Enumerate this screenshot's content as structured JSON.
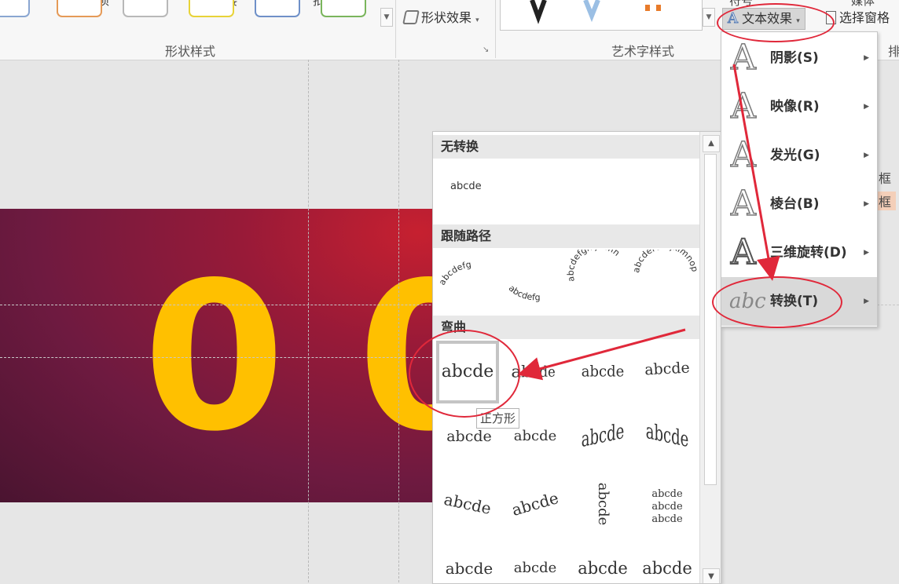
{
  "ribbon": {
    "top_tabs": [
      "加载项",
      "链接",
      "批注",
      "文本",
      "符号",
      "媒体"
    ],
    "shape_effects_label": "形状效果",
    "text_effects_label": "文本效果",
    "selection_pane_label": "选择窗格",
    "group_shape_styles": "形状样式",
    "group_wordart_styles": "艺术字样式",
    "group_arrange_partial": "排"
  },
  "slide": {
    "digit_1": "0",
    "digit_2": "0",
    "bg_colors": [
      "#c62030",
      "#6e1a40",
      "#4a1430"
    ],
    "digit_color": "#ffc000"
  },
  "side_panel": {
    "line1": "框",
    "line2": "框"
  },
  "text_effects_menu": {
    "items": [
      {
        "icon": "shadow-icon",
        "label": "阴影(S)"
      },
      {
        "icon": "reflection-icon",
        "label": "映像(R)"
      },
      {
        "icon": "glow-icon",
        "label": "发光(G)"
      },
      {
        "icon": "bevel-icon",
        "label": "棱台(B)"
      },
      {
        "icon": "3d-rotation-icon",
        "label": "三维旋转(D)"
      },
      {
        "icon": "transform-icon",
        "label": "转换(T)",
        "icon_text": "abc"
      }
    ]
  },
  "transform_gallery": {
    "section_no_transform": "无转换",
    "no_transform_sample": "abcde",
    "section_follow_path": "跟随路径",
    "section_warp": "弯曲",
    "warp_sample": "abcde",
    "path_samples": [
      "abcdefg",
      "abcdefg",
      "abcdefghijklmn",
      "abcdefGhijklmnop"
    ],
    "tooltip": "正方形"
  },
  "annotation_color": "#e0283a"
}
